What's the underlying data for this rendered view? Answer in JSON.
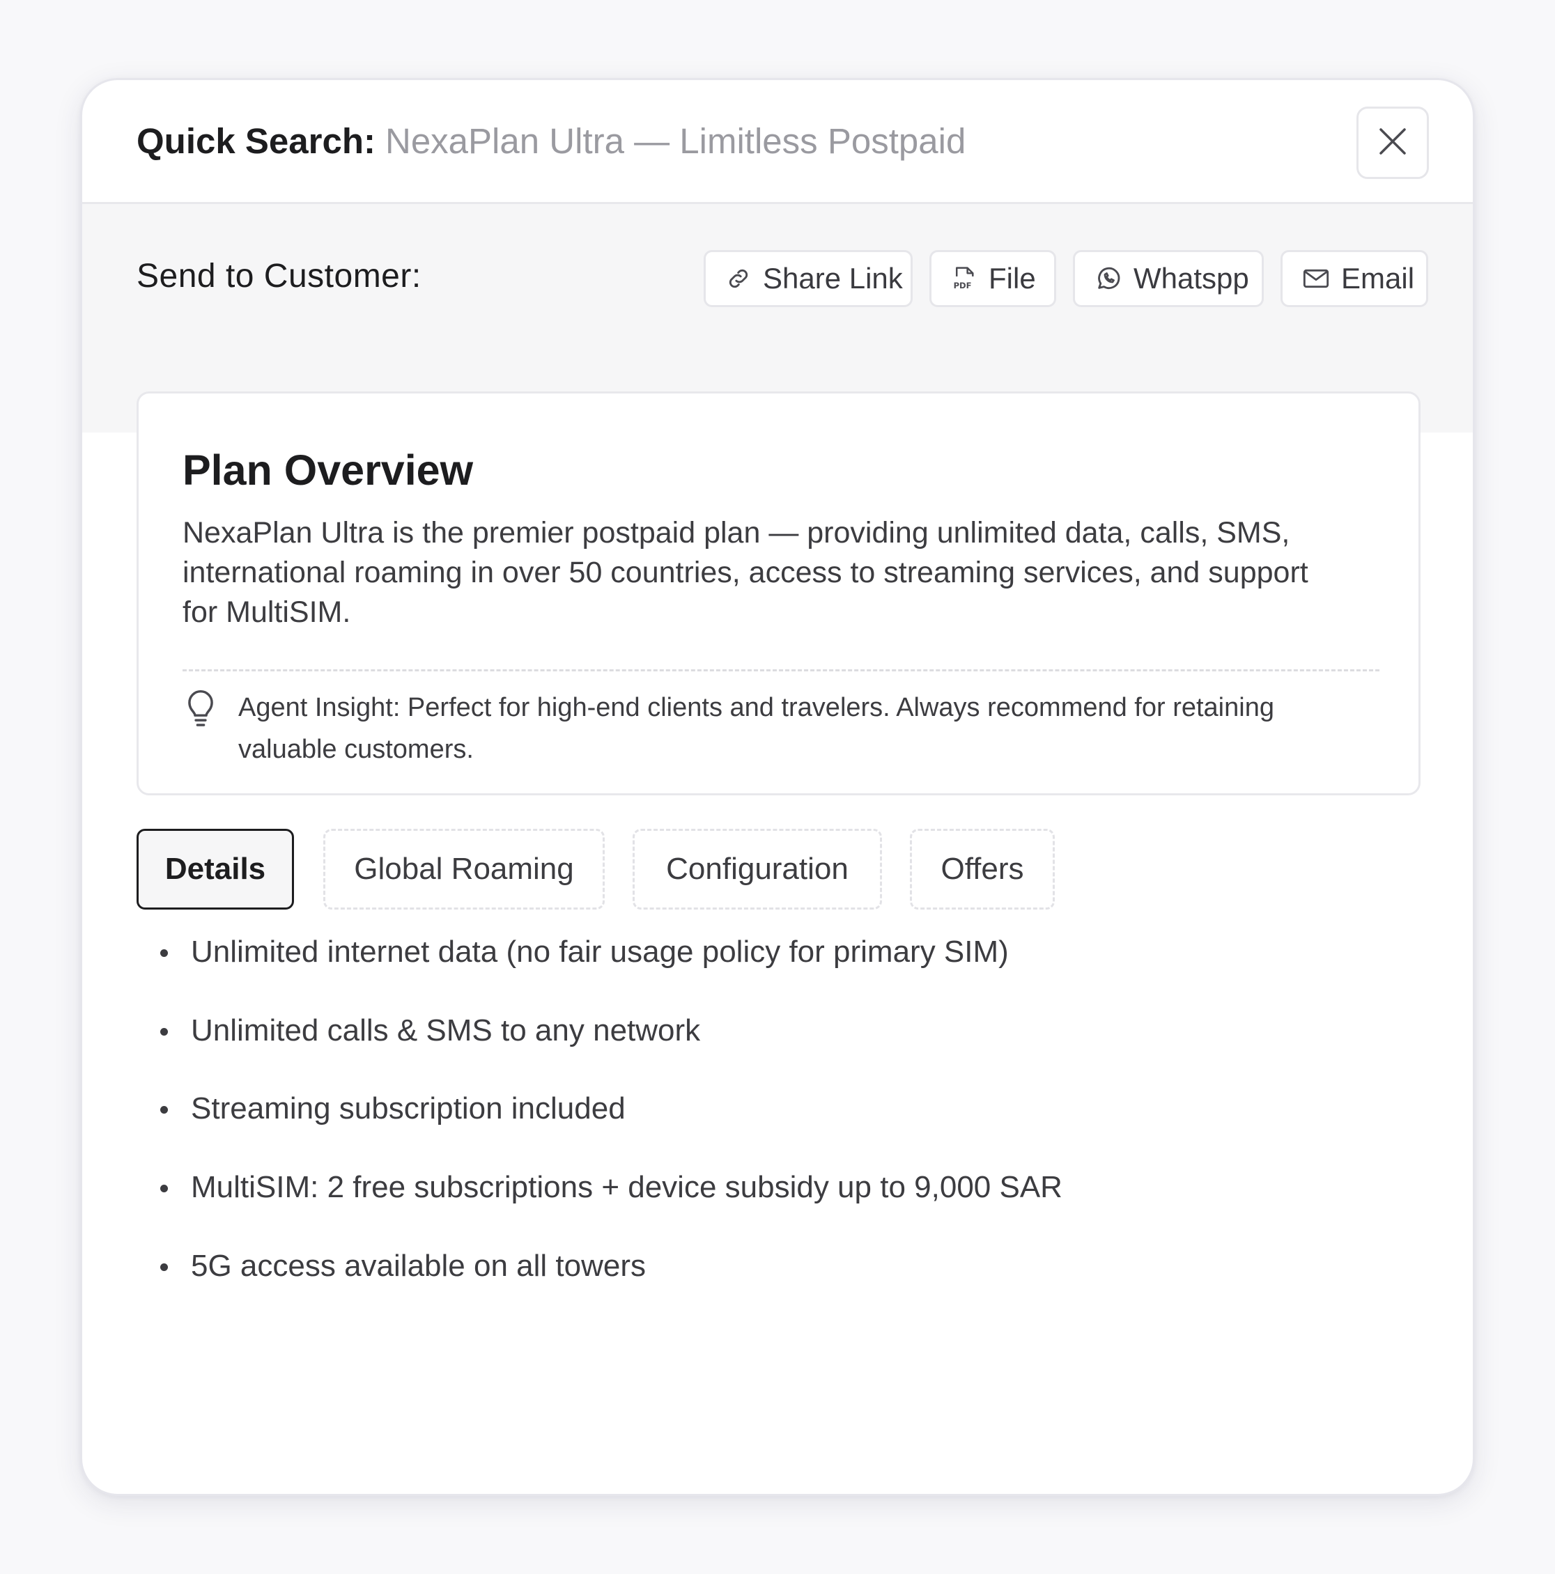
{
  "header": {
    "title": "Quick Search:",
    "subtitle": "NexaPlan Ultra — Limitless Postpaid",
    "close_icon": "close-icon"
  },
  "share": {
    "label": "Send to Customer:",
    "buttons": [
      {
        "label": "Share Link",
        "icon": "link-icon"
      },
      {
        "label": "File",
        "icon": "pdf-file-icon"
      },
      {
        "label": "Whatspp",
        "icon": "whatsapp-icon"
      },
      {
        "label": "Email",
        "icon": "mail-icon"
      }
    ]
  },
  "overview": {
    "title": "Plan Overview",
    "description": "NexaPlan Ultra is the premier postpaid plan — providing unlimited data, calls, SMS, international roaming in over 50 countries, access to streaming services, and support for MultiSIM.",
    "insight_icon": "lightbulb-icon",
    "insight": "Agent Insight: Perfect for high-end clients and travelers. Always recommend for retaining valuable customers."
  },
  "tabs": [
    {
      "label": "Details",
      "active": true
    },
    {
      "label": "Global Roaming",
      "active": false
    },
    {
      "label": "Configuration",
      "active": false
    },
    {
      "label": "Offers",
      "active": false
    }
  ],
  "features": [
    "Unlimited internet data (no fair usage policy for primary SIM)",
    "Unlimited calls & SMS to any network",
    "Streaming subscription included",
    "MultiSIM: 2 free subscriptions + device subsidy up to 9,000 SAR",
    "5G access available on all towers"
  ],
  "colors": {
    "text": "#1d1d1f",
    "muted": "#9a9aa0",
    "panel": "#f6f6f7",
    "border": "#e6e6ea"
  }
}
